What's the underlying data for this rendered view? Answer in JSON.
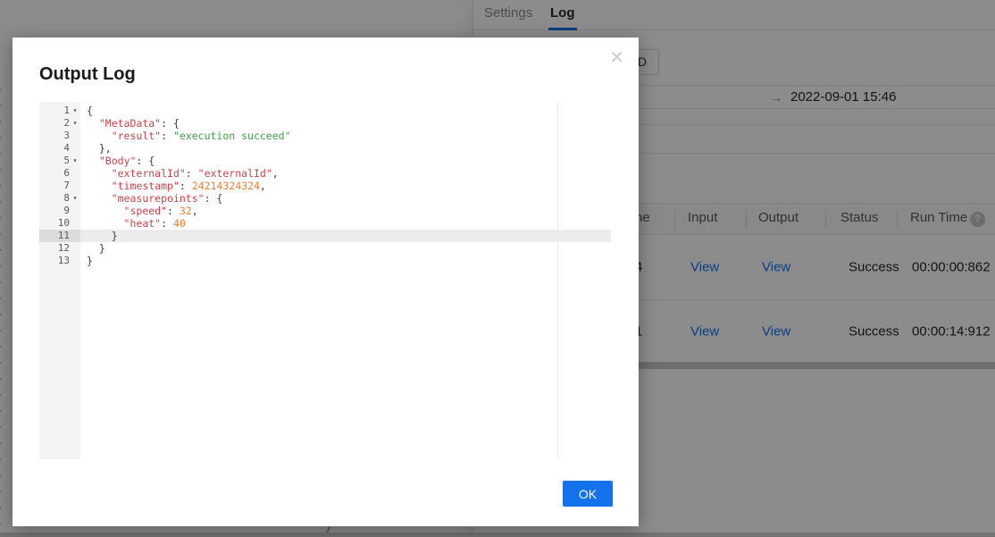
{
  "colors": {
    "brand_blue": "#1372ec",
    "code_key": "#c7454d",
    "code_string": "#43a047",
    "code_number": "#e8833a",
    "code_punct": "#3d3d3d"
  },
  "background": {
    "tabs": {
      "settings": "Settings",
      "log": "Log"
    },
    "partial_button_text": "D",
    "run_row": {
      "arrow": "→",
      "datetime": "2022-09-01 15:46"
    },
    "table": {
      "header_fragment": "ne",
      "headers": {
        "input": "Input",
        "output": "Output",
        "status": "Status",
        "run_time": "Run Time"
      },
      "help_icon": "?",
      "rows": [
        {
          "fragment": "4",
          "input": "View",
          "output": "View",
          "status": "Success",
          "run_time": "00:00:00:862"
        },
        {
          "fragment": "1",
          "input": "View",
          "output": "View",
          "status": "Success",
          "run_time": "00:00:14:912"
        }
      ]
    }
  },
  "modal": {
    "title": "Output Log",
    "close_icon": "✕",
    "ok_label": "OK",
    "editor": {
      "active_line": 11,
      "lines": [
        {
          "n": 1,
          "fold": true,
          "indent": 0,
          "tokens": [
            {
              "t": "punc",
              "v": "{"
            }
          ]
        },
        {
          "n": 2,
          "fold": true,
          "indent": 1,
          "tokens": [
            {
              "t": "key",
              "v": "\"MetaData\""
            },
            {
              "t": "punc",
              "v": ": {"
            }
          ]
        },
        {
          "n": 3,
          "fold": false,
          "indent": 2,
          "tokens": [
            {
              "t": "key",
              "v": "\"result\""
            },
            {
              "t": "punc",
              "v": ": "
            },
            {
              "t": "str",
              "v": "\"execution succeed\""
            }
          ]
        },
        {
          "n": 4,
          "fold": false,
          "indent": 1,
          "tokens": [
            {
              "t": "punc",
              "v": "},"
            }
          ]
        },
        {
          "n": 5,
          "fold": true,
          "indent": 1,
          "tokens": [
            {
              "t": "key",
              "v": "\"Body\""
            },
            {
              "t": "punc",
              "v": ": {"
            }
          ]
        },
        {
          "n": 6,
          "fold": false,
          "indent": 2,
          "tokens": [
            {
              "t": "key",
              "v": "\"externalId\""
            },
            {
              "t": "punc",
              "v": ": "
            },
            {
              "t": "key",
              "v": "\"externalId\""
            },
            {
              "t": "punc",
              "v": ","
            }
          ]
        },
        {
          "n": 7,
          "fold": false,
          "indent": 2,
          "tokens": [
            {
              "t": "key",
              "v": "\"timestamp\""
            },
            {
              "t": "punc",
              "v": ": "
            },
            {
              "t": "num",
              "v": "24214324324"
            },
            {
              "t": "punc",
              "v": ","
            }
          ]
        },
        {
          "n": 8,
          "fold": true,
          "indent": 2,
          "tokens": [
            {
              "t": "key",
              "v": "\"measurepoints\""
            },
            {
              "t": "punc",
              "v": ": {"
            }
          ]
        },
        {
          "n": 9,
          "fold": false,
          "indent": 3,
          "tokens": [
            {
              "t": "key",
              "v": "\"speed\""
            },
            {
              "t": "punc",
              "v": ": "
            },
            {
              "t": "num",
              "v": "32"
            },
            {
              "t": "punc",
              "v": ","
            }
          ]
        },
        {
          "n": 10,
          "fold": false,
          "indent": 3,
          "tokens": [
            {
              "t": "key",
              "v": "\"heat\""
            },
            {
              "t": "punc",
              "v": ": "
            },
            {
              "t": "num",
              "v": "40"
            }
          ]
        },
        {
          "n": 11,
          "fold": false,
          "indent": 2,
          "tokens": [
            {
              "t": "punc",
              "v": "}"
            }
          ]
        },
        {
          "n": 12,
          "fold": false,
          "indent": 1,
          "tokens": [
            {
              "t": "punc",
              "v": "}"
            }
          ]
        },
        {
          "n": 13,
          "fold": false,
          "indent": 0,
          "tokens": [
            {
              "t": "punc",
              "v": "}"
            }
          ]
        }
      ]
    }
  }
}
